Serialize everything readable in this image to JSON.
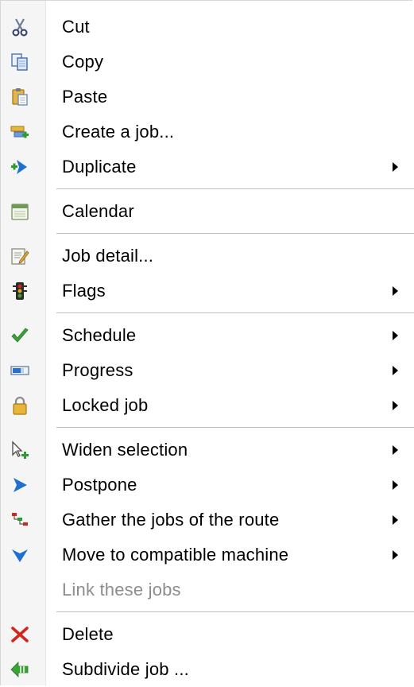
{
  "menu": {
    "items": [
      {
        "label": "Cut",
        "icon": "scissors-icon",
        "submenu": false,
        "enabled": true
      },
      {
        "label": "Copy",
        "icon": "copy-icon",
        "submenu": false,
        "enabled": true
      },
      {
        "label": "Paste",
        "icon": "paste-icon",
        "submenu": false,
        "enabled": true
      },
      {
        "label": "Create a job...",
        "icon": "create-job-icon",
        "submenu": false,
        "enabled": true
      },
      {
        "label": "Duplicate",
        "icon": "duplicate-icon",
        "submenu": true,
        "enabled": true
      },
      {
        "label": "Calendar",
        "icon": "calendar-icon",
        "submenu": false,
        "enabled": true
      },
      {
        "label": "Job detail...",
        "icon": "job-detail-icon",
        "submenu": false,
        "enabled": true
      },
      {
        "label": "Flags",
        "icon": "traffic-light-icon",
        "submenu": true,
        "enabled": true
      },
      {
        "label": "Schedule",
        "icon": "checkmark-icon",
        "submenu": true,
        "enabled": true
      },
      {
        "label": "Progress",
        "icon": "progress-bar-icon",
        "submenu": true,
        "enabled": true
      },
      {
        "label": "Locked job",
        "icon": "padlock-icon",
        "submenu": true,
        "enabled": true
      },
      {
        "label": "Widen selection",
        "icon": "cursor-plus-icon",
        "submenu": true,
        "enabled": true
      },
      {
        "label": "Postpone",
        "icon": "chevron-right-icon",
        "submenu": true,
        "enabled": true
      },
      {
        "label": "Gather the jobs of the route",
        "icon": "gather-route-icon",
        "submenu": true,
        "enabled": true
      },
      {
        "label": "Move to compatible machine",
        "icon": "chevron-down-icon",
        "submenu": true,
        "enabled": true
      },
      {
        "label": "Link these jobs",
        "icon": "",
        "submenu": false,
        "enabled": false
      },
      {
        "label": "Delete",
        "icon": "delete-x-icon",
        "submenu": false,
        "enabled": true
      },
      {
        "label": "Subdivide job ...",
        "icon": "subdivide-icon",
        "submenu": false,
        "enabled": true
      }
    ]
  },
  "colors": {
    "text": "#000000",
    "disabled_text": "#8d8d8d",
    "separator": "#bdbdbd",
    "icon_blue": "#1f6fd1",
    "icon_green": "#3aa335",
    "icon_red": "#d2261d",
    "icon_yellow": "#e0a91c"
  }
}
